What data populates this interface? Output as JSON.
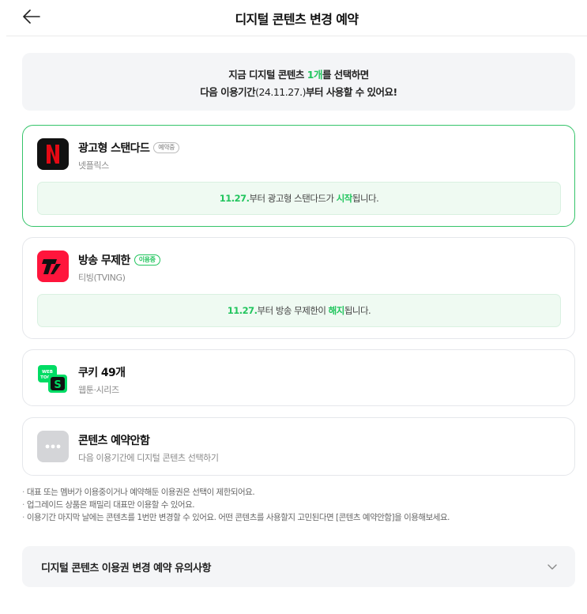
{
  "header": {
    "title": "디지털 콘텐츠 변경 예약",
    "back_icon": "arrow-left-icon"
  },
  "notice": {
    "line1_before": "지금 디지털 콘텐츠 ",
    "line1_highlight": "1개",
    "line1_after": "를 선택하면",
    "line2_before": "다음 이용기간",
    "line2_date": "(24.11.27.)",
    "line2_after": "부터 사용할 수 있어요!"
  },
  "cards": [
    {
      "title": "광고형 스탠다드",
      "badge": "예약중",
      "subtitle": "넷플릭스",
      "logo_icon": "netflix-logo-icon",
      "logo_text": "N",
      "info": {
        "date": "11.27.",
        "mid": "부터 광고형 스탠다드가 ",
        "action": "시작",
        "end": "됩니다."
      }
    },
    {
      "title": "방송 무제한",
      "badge": "이용중",
      "subtitle": "티빙(TVING)",
      "logo_icon": "tving-logo-icon",
      "logo_text": "T",
      "info": {
        "date": "11.27.",
        "mid": "부터 방송 무제한이 ",
        "action": "해지",
        "end": "됩니다."
      }
    },
    {
      "title": "쿠키 49개",
      "subtitle": "웹툰·시리즈",
      "logo_icon": "webtoon-logo-icon",
      "logo_text": "WEB TOON"
    },
    {
      "title": "콘텐츠 예약안함",
      "subtitle": "다음 이용기간에 디지털 콘텐츠 선택하기",
      "logo_icon": "more-dots-icon"
    }
  ],
  "tips": [
    "대표 또는 멤버가 이용중이거나 예약해둔 이용권은 선택이 제한되어요.",
    "업그레이드 상품은 패밀리 대표만 이용할 수 있어요.",
    "이용기간 마지막 날에는 콘텐츠를 1번만 변경할 수 있어요. 어떤 콘텐츠를 사용할지 고민된다면 [콘텐츠 예약안함]을 이용해보세요."
  ],
  "accordion": {
    "title": "디지털 콘텐츠 이용권 변경 예약 유의사항",
    "icon": "chevron-down-icon"
  },
  "colors": {
    "accent_green": "#22c55e",
    "netflix_red": "#e50914",
    "tving_red": "#ff153c",
    "webtoon_green": "#00dc64"
  }
}
